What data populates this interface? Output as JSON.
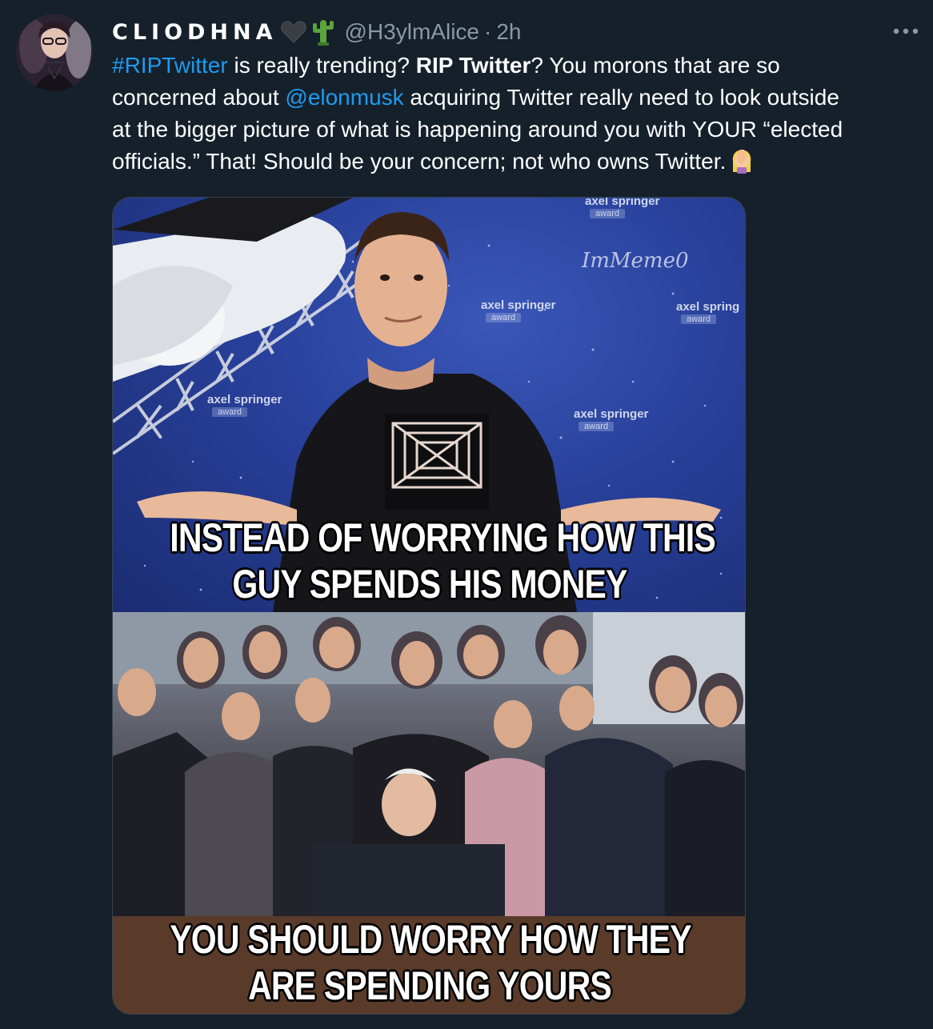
{
  "author": {
    "display_name": "CLIODHNA",
    "name_emojis": [
      "black-heart-icon",
      "cactus-icon"
    ],
    "handle": "@H3ylmAlice",
    "separator": "·",
    "time": "2h"
  },
  "more_label": "···",
  "tweet": {
    "lines": [
      [
        {
          "text": "#RIPTwitter",
          "style": "link"
        },
        {
          "text": " is really trending? ",
          "style": "plain"
        },
        {
          "text": "RIP Twitter",
          "style": "bold"
        },
        {
          "text": "? You morons that are so",
          "style": "plain"
        }
      ],
      [
        {
          "text": "concerned about ",
          "style": "plain"
        },
        {
          "text": "@elonmusk",
          "style": "link"
        },
        {
          "text": " acquiring Twitter really need to look outside",
          "style": "plain"
        }
      ],
      [
        {
          "text": "at the bigger picture of what is happening around you with YOUR “elected",
          "style": "plain"
        }
      ],
      [
        {
          "text": "officials.” That! Should be your concern; not who owns Twitter.",
          "style": "plain"
        }
      ]
    ],
    "trailing_emoji": "woman-facepalming-icon"
  },
  "media": {
    "watermark": "ImMeme0",
    "backdrop_brand": [
      {
        "text": "axel springer",
        "award": "award"
      },
      {
        "text": "axel springer",
        "award": "award"
      },
      {
        "text": "axel springer",
        "award": "award"
      },
      {
        "text": "axel springer",
        "award": "award"
      },
      {
        "text": "axel spring",
        "award": "award"
      }
    ],
    "caption_top": [
      "INSTEAD OF WORRYING  HOW THIS",
      "GUY SPENDS HIS MONEY"
    ],
    "caption_bottom": [
      "YOU SHOULD WORRY HOW THEY",
      "ARE SPENDING YOURS"
    ]
  },
  "colors": {
    "background": "#15202b",
    "link": "#1d9bf0",
    "secondary_text": "#8b98a5"
  }
}
